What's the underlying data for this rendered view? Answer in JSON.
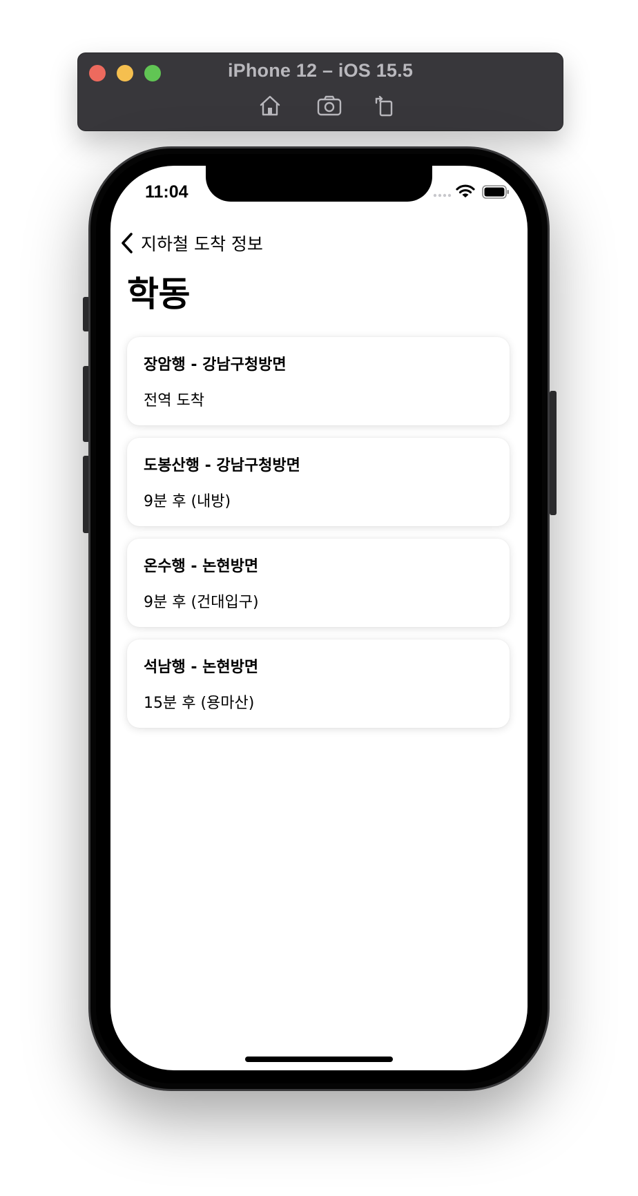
{
  "simulator": {
    "title": "iPhone 12 – iOS 15.5",
    "toolbar_icons": [
      "home-icon",
      "screenshot-icon",
      "rotate-icon"
    ],
    "traffic_lights": {
      "close": "#ed6a5e",
      "minimize": "#f5bf4f",
      "zoom": "#61c554"
    }
  },
  "status_bar": {
    "time": "11:04",
    "icons": [
      "cellular-signal-icon",
      "wifi-icon",
      "battery-icon"
    ]
  },
  "nav": {
    "back_label": "지하철 도착 정보",
    "title": "학동"
  },
  "arrivals": [
    {
      "title": "장암행 - 강남구청방면",
      "status": "전역 도착"
    },
    {
      "title": "도봉산행 - 강남구청방면",
      "status": "9분 후 (내방)"
    },
    {
      "title": "온수행 - 논현방면",
      "status": "9분 후 (건대입구)"
    },
    {
      "title": "석남행 - 논현방면",
      "status": "15분 후 (용마산)"
    }
  ],
  "colors": {
    "titlebar": "#38373b",
    "card_background": "#ffffff",
    "text": "#000000"
  }
}
